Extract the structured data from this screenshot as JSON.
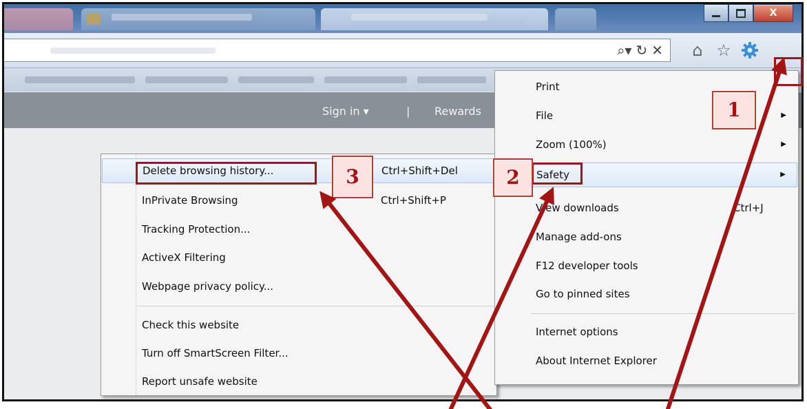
{
  "window": {
    "close_label": "X"
  },
  "toolbar": {
    "address_tools": [
      "search-dropdown-icon",
      "refresh-icon",
      "stop-icon"
    ],
    "nav_icons": [
      "home-icon",
      "favorites-star-icon",
      "tools-gear-icon"
    ]
  },
  "site_header": {
    "signin_label": "Sign in ▾",
    "separator": "|",
    "rewards_label": "Rewards"
  },
  "tools_menu": {
    "items": [
      {
        "label": "Print",
        "shortcut": "",
        "submenu": false
      },
      {
        "label": "File",
        "shortcut": "",
        "submenu": true
      },
      {
        "label": "Zoom (100%)",
        "shortcut": "",
        "submenu": true
      },
      {
        "label": "Safety",
        "shortcut": "",
        "submenu": true,
        "highlighted": true
      },
      {
        "label": "View downloads",
        "shortcut": "Ctrl+J",
        "submenu": false
      },
      {
        "label": "Manage add-ons",
        "shortcut": "",
        "submenu": false
      },
      {
        "label": "F12 developer tools",
        "shortcut": "",
        "submenu": false
      },
      {
        "label": "Go to pinned sites",
        "shortcut": "",
        "submenu": false
      },
      {
        "label": "Internet options",
        "shortcut": "",
        "submenu": false
      },
      {
        "label": "About Internet Explorer",
        "shortcut": "",
        "submenu": false
      }
    ]
  },
  "safety_submenu": {
    "items": [
      {
        "label": "Delete browsing history...",
        "shortcut": "Ctrl+Shift+Del",
        "highlighted": true
      },
      {
        "label": "InPrivate Browsing",
        "shortcut": "Ctrl+Shift+P"
      },
      {
        "label": "Tracking Protection...",
        "shortcut": ""
      },
      {
        "label": "ActiveX Filtering",
        "shortcut": ""
      },
      {
        "label": "Webpage privacy policy...",
        "shortcut": ""
      },
      {
        "label": "Check this website",
        "shortcut": ""
      },
      {
        "label": "Turn off SmartScreen Filter...",
        "shortcut": ""
      },
      {
        "label": "Report unsafe website",
        "shortcut": ""
      }
    ]
  },
  "annotations": {
    "step1": "1",
    "step2": "2",
    "step3": "3",
    "color": "#a31515"
  }
}
